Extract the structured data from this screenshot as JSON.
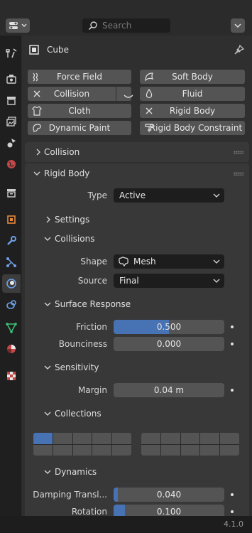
{
  "search": {
    "placeholder": "Search"
  },
  "header": {
    "object_name": "Cube"
  },
  "physics_buttons": {
    "force_field": "Force Field",
    "soft_body": "Soft Body",
    "collision": "Collision",
    "fluid": "Fluid",
    "cloth": "Cloth",
    "rigid_body": "Rigid Body",
    "dynamic_paint": "Dynamic Paint",
    "rigid_body_constraint": "Rigid Body Constraint"
  },
  "panels": {
    "collision_title": "Collision",
    "rigid_body_title": "Rigid Body",
    "type_label": "Type",
    "type_value": "Active",
    "settings_title": "Settings",
    "collisions_title": "Collisions",
    "shape_label": "Shape",
    "shape_value": "Mesh",
    "source_label": "Source",
    "source_value": "Final",
    "surface_response_title": "Surface Response",
    "friction_label": "Friction",
    "friction_value": "0.500",
    "friction_fraction": 0.5,
    "bounciness_label": "Bounciness",
    "bounciness_value": "0.000",
    "sensitivity_title": "Sensitivity",
    "margin_label": "Margin",
    "margin_value": "0.04 m",
    "collections_title": "Collections",
    "collections_active": [
      0
    ],
    "dynamics_title": "Dynamics",
    "damping_translation_label": "Damping Transl...",
    "damping_translation_value": "0.040",
    "damping_translation_fraction": 0.04,
    "rotation_label": "Rotation",
    "rotation_value": "0.100",
    "rotation_fraction": 0.1
  },
  "status": {
    "version": "4.1.0"
  },
  "colors": {
    "accent": "#4772b3",
    "background": "#2b2b2b",
    "panel": "#383838",
    "button": "#545454"
  }
}
